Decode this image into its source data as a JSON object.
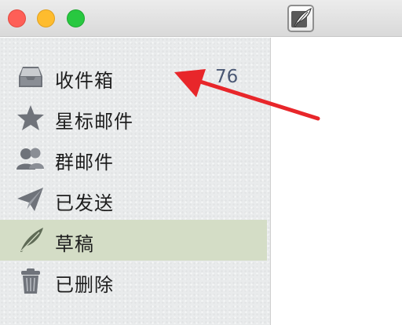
{
  "window": {
    "compose_button": "compose-icon"
  },
  "sidebar": {
    "items": [
      {
        "label": "收件箱",
        "icon": "inbox-icon",
        "badge": "76",
        "selected": false
      },
      {
        "label": "星标邮件",
        "icon": "star-icon",
        "selected": false
      },
      {
        "label": "群邮件",
        "icon": "group-icon",
        "selected": false
      },
      {
        "label": "已发送",
        "icon": "paper-plane-icon",
        "selected": false
      },
      {
        "label": "草稿",
        "icon": "quill-icon",
        "selected": true
      },
      {
        "label": "已删除",
        "icon": "trash-icon",
        "selected": false
      }
    ]
  },
  "colors": {
    "annotation_arrow": "#e8262a",
    "selected_row": "#d4ddc6",
    "badge_text": "#4a5874"
  }
}
